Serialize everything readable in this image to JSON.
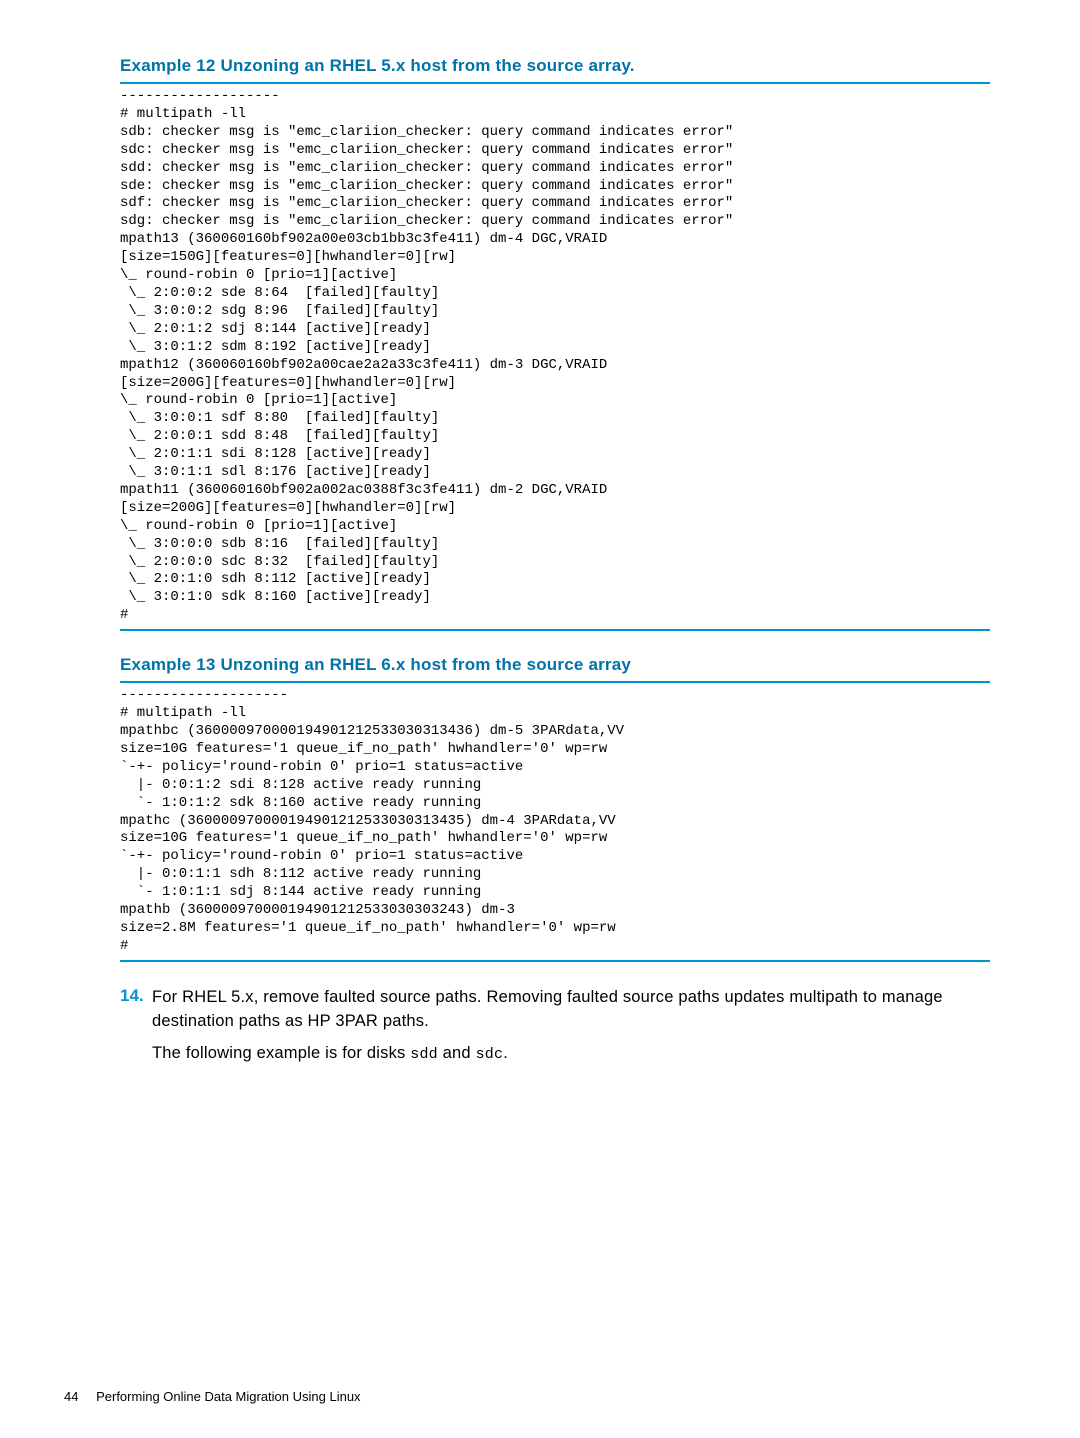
{
  "example12": {
    "heading": "Example 12 Unzoning an RHEL 5.x host from the source array.",
    "code": "-------------------\n# multipath -ll\nsdb: checker msg is \"emc_clariion_checker: query command indicates error\"\nsdc: checker msg is \"emc_clariion_checker: query command indicates error\"\nsdd: checker msg is \"emc_clariion_checker: query command indicates error\"\nsde: checker msg is \"emc_clariion_checker: query command indicates error\"\nsdf: checker msg is \"emc_clariion_checker: query command indicates error\"\nsdg: checker msg is \"emc_clariion_checker: query command indicates error\"\nmpath13 (360060160bf902a00e03cb1bb3c3fe411) dm-4 DGC,VRAID\n[size=150G][features=0][hwhandler=0][rw]\n\\_ round-robin 0 [prio=1][active]\n \\_ 2:0:0:2 sde 8:64  [failed][faulty]\n \\_ 3:0:0:2 sdg 8:96  [failed][faulty]\n \\_ 2:0:1:2 sdj 8:144 [active][ready]\n \\_ 3:0:1:2 sdm 8:192 [active][ready]\nmpath12 (360060160bf902a00cae2a2a33c3fe411) dm-3 DGC,VRAID\n[size=200G][features=0][hwhandler=0][rw]\n\\_ round-robin 0 [prio=1][active]\n \\_ 3:0:0:1 sdf 8:80  [failed][faulty]\n \\_ 2:0:0:1 sdd 8:48  [failed][faulty]\n \\_ 2:0:1:1 sdi 8:128 [active][ready]\n \\_ 3:0:1:1 sdl 8:176 [active][ready]\nmpath11 (360060160bf902a002ac0388f3c3fe411) dm-2 DGC,VRAID\n[size=200G][features=0][hwhandler=0][rw]\n\\_ round-robin 0 [prio=1][active]\n \\_ 3:0:0:0 sdb 8:16  [failed][faulty]\n \\_ 2:0:0:0 sdc 8:32  [failed][faulty]\n \\_ 2:0:1:0 sdh 8:112 [active][ready]\n \\_ 3:0:1:0 sdk 8:160 [active][ready]\n#"
  },
  "example13": {
    "heading": "Example 13 Unzoning an RHEL 6.x host from the source array",
    "code": "--------------------\n# multipath -ll\nmpathbc (360000970000194901212533030313436) dm-5 3PARdata,VV\nsize=10G features='1 queue_if_no_path' hwhandler='0' wp=rw\n`-+- policy='round-robin 0' prio=1 status=active\n  |- 0:0:1:2 sdi 8:128 active ready running\n  `- 1:0:1:2 sdk 8:160 active ready running\nmpathc (360000970000194901212533030313435) dm-4 3PARdata,VV\nsize=10G features='1 queue_if_no_path' hwhandler='0' wp=rw\n`-+- policy='round-robin 0' prio=1 status=active\n  |- 0:0:1:1 sdh 8:112 active ready running\n  `- 1:0:1:1 sdj 8:144 active ready running\nmpathb (360000970000194901212533030303243) dm-3\nsize=2.8M features='1 queue_if_no_path' hwhandler='0' wp=rw\n#"
  },
  "step14": {
    "number": "14.",
    "para1_a": "For RHEL 5.x, remove faulted source paths. Removing faulted source paths updates multipath to manage destination paths as HP 3PAR paths.",
    "para2_a": "The following example is for disks ",
    "para2_code1": "sdd",
    "para2_b": " and ",
    "para2_code2": "sdc",
    "para2_c": "."
  },
  "footer": {
    "page": "44",
    "title": "Performing Online Data Migration Using Linux"
  }
}
